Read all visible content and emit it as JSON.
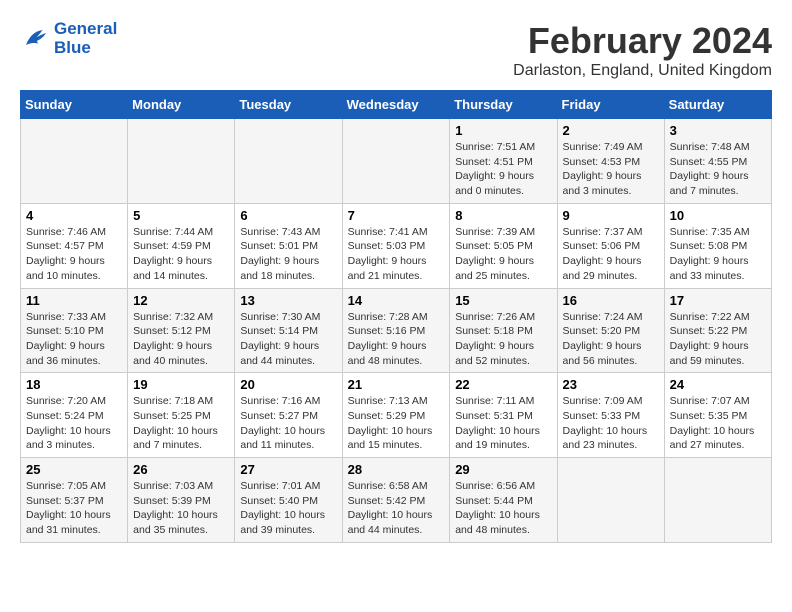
{
  "header": {
    "logo_line1": "General",
    "logo_line2": "Blue",
    "month_title": "February 2024",
    "location": "Darlaston, England, United Kingdom"
  },
  "weekdays": [
    "Sunday",
    "Monday",
    "Tuesday",
    "Wednesday",
    "Thursday",
    "Friday",
    "Saturday"
  ],
  "weeks": [
    [
      {
        "day": "",
        "info": ""
      },
      {
        "day": "",
        "info": ""
      },
      {
        "day": "",
        "info": ""
      },
      {
        "day": "",
        "info": ""
      },
      {
        "day": "1",
        "info": "Sunrise: 7:51 AM\nSunset: 4:51 PM\nDaylight: 9 hours\nand 0 minutes."
      },
      {
        "day": "2",
        "info": "Sunrise: 7:49 AM\nSunset: 4:53 PM\nDaylight: 9 hours\nand 3 minutes."
      },
      {
        "day": "3",
        "info": "Sunrise: 7:48 AM\nSunset: 4:55 PM\nDaylight: 9 hours\nand 7 minutes."
      }
    ],
    [
      {
        "day": "4",
        "info": "Sunrise: 7:46 AM\nSunset: 4:57 PM\nDaylight: 9 hours\nand 10 minutes."
      },
      {
        "day": "5",
        "info": "Sunrise: 7:44 AM\nSunset: 4:59 PM\nDaylight: 9 hours\nand 14 minutes."
      },
      {
        "day": "6",
        "info": "Sunrise: 7:43 AM\nSunset: 5:01 PM\nDaylight: 9 hours\nand 18 minutes."
      },
      {
        "day": "7",
        "info": "Sunrise: 7:41 AM\nSunset: 5:03 PM\nDaylight: 9 hours\nand 21 minutes."
      },
      {
        "day": "8",
        "info": "Sunrise: 7:39 AM\nSunset: 5:05 PM\nDaylight: 9 hours\nand 25 minutes."
      },
      {
        "day": "9",
        "info": "Sunrise: 7:37 AM\nSunset: 5:06 PM\nDaylight: 9 hours\nand 29 minutes."
      },
      {
        "day": "10",
        "info": "Sunrise: 7:35 AM\nSunset: 5:08 PM\nDaylight: 9 hours\nand 33 minutes."
      }
    ],
    [
      {
        "day": "11",
        "info": "Sunrise: 7:33 AM\nSunset: 5:10 PM\nDaylight: 9 hours\nand 36 minutes."
      },
      {
        "day": "12",
        "info": "Sunrise: 7:32 AM\nSunset: 5:12 PM\nDaylight: 9 hours\nand 40 minutes."
      },
      {
        "day": "13",
        "info": "Sunrise: 7:30 AM\nSunset: 5:14 PM\nDaylight: 9 hours\nand 44 minutes."
      },
      {
        "day": "14",
        "info": "Sunrise: 7:28 AM\nSunset: 5:16 PM\nDaylight: 9 hours\nand 48 minutes."
      },
      {
        "day": "15",
        "info": "Sunrise: 7:26 AM\nSunset: 5:18 PM\nDaylight: 9 hours\nand 52 minutes."
      },
      {
        "day": "16",
        "info": "Sunrise: 7:24 AM\nSunset: 5:20 PM\nDaylight: 9 hours\nand 56 minutes."
      },
      {
        "day": "17",
        "info": "Sunrise: 7:22 AM\nSunset: 5:22 PM\nDaylight: 9 hours\nand 59 minutes."
      }
    ],
    [
      {
        "day": "18",
        "info": "Sunrise: 7:20 AM\nSunset: 5:24 PM\nDaylight: 10 hours\nand 3 minutes."
      },
      {
        "day": "19",
        "info": "Sunrise: 7:18 AM\nSunset: 5:25 PM\nDaylight: 10 hours\nand 7 minutes."
      },
      {
        "day": "20",
        "info": "Sunrise: 7:16 AM\nSunset: 5:27 PM\nDaylight: 10 hours\nand 11 minutes."
      },
      {
        "day": "21",
        "info": "Sunrise: 7:13 AM\nSunset: 5:29 PM\nDaylight: 10 hours\nand 15 minutes."
      },
      {
        "day": "22",
        "info": "Sunrise: 7:11 AM\nSunset: 5:31 PM\nDaylight: 10 hours\nand 19 minutes."
      },
      {
        "day": "23",
        "info": "Sunrise: 7:09 AM\nSunset: 5:33 PM\nDaylight: 10 hours\nand 23 minutes."
      },
      {
        "day": "24",
        "info": "Sunrise: 7:07 AM\nSunset: 5:35 PM\nDaylight: 10 hours\nand 27 minutes."
      }
    ],
    [
      {
        "day": "25",
        "info": "Sunrise: 7:05 AM\nSunset: 5:37 PM\nDaylight: 10 hours\nand 31 minutes."
      },
      {
        "day": "26",
        "info": "Sunrise: 7:03 AM\nSunset: 5:39 PM\nDaylight: 10 hours\nand 35 minutes."
      },
      {
        "day": "27",
        "info": "Sunrise: 7:01 AM\nSunset: 5:40 PM\nDaylight: 10 hours\nand 39 minutes."
      },
      {
        "day": "28",
        "info": "Sunrise: 6:58 AM\nSunset: 5:42 PM\nDaylight: 10 hours\nand 44 minutes."
      },
      {
        "day": "29",
        "info": "Sunrise: 6:56 AM\nSunset: 5:44 PM\nDaylight: 10 hours\nand 48 minutes."
      },
      {
        "day": "",
        "info": ""
      },
      {
        "day": "",
        "info": ""
      }
    ]
  ]
}
